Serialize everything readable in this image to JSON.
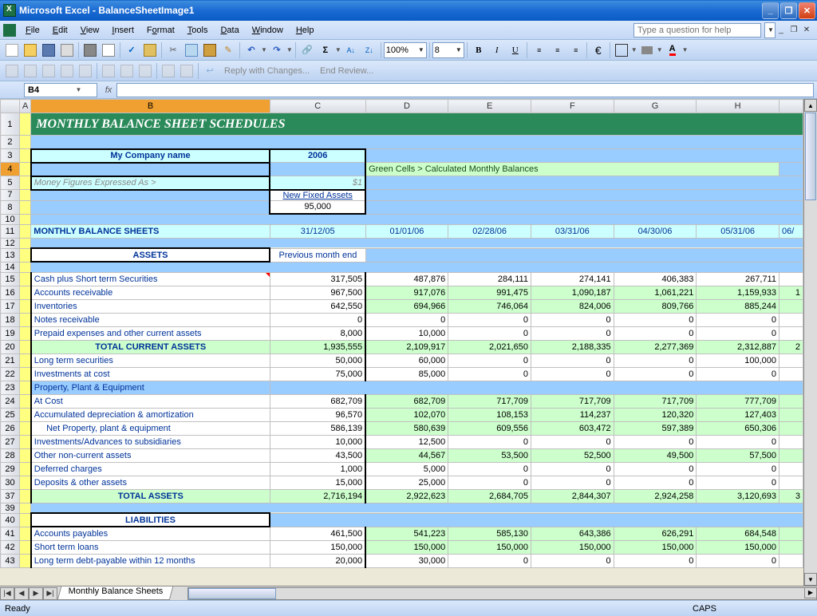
{
  "window": {
    "title": "Microsoft Excel - BalanceSheetImage1"
  },
  "menu": [
    "File",
    "Edit",
    "View",
    "Insert",
    "Format",
    "Tools",
    "Data",
    "Window",
    "Help"
  ],
  "help_placeholder": "Type a question for help",
  "toolbar": {
    "zoom": "100%",
    "font_size": "8",
    "reply_text": "Reply with Changes...",
    "end_review": "End Review..."
  },
  "cell_ref": "B4",
  "columns": [
    "A",
    "B",
    "C",
    "D",
    "E",
    "F",
    "G",
    "H"
  ],
  "sheet": {
    "title": "MONTHLY BALANCE SHEET SCHEDULES",
    "company_label": "My Company name",
    "year": "2006",
    "calc_note": "Green Cells > Calculated Monthly Balances",
    "money_expr": "Money Figures Expressed As >",
    "money_val": "$1",
    "new_fixed_assets_label": "New Fixed Assets",
    "new_fixed_assets_val": "95,000",
    "monthly_sheets": "MONTHLY BALANCE SHEETS",
    "prev_month": "Previous month end",
    "dates": [
      "31/12/05",
      "01/01/06",
      "02/28/06",
      "03/31/06",
      "04/30/06",
      "05/31/06"
    ],
    "date_partial": "06/",
    "assets_hdr": "ASSETS",
    "ppe_hdr": "Property, Plant & Equipment",
    "liab_hdr": "LIABILITIES",
    "rows": [
      {
        "n": "15",
        "lbl": "Cash plus Short term Securities",
        "c": "317,505",
        "v": [
          "487,876",
          "284,111",
          "274,141",
          "406,383",
          "267,711"
        ],
        "white": true,
        "red": true
      },
      {
        "n": "16",
        "lbl": "Accounts receivable",
        "c": "967,500",
        "v": [
          "917,076",
          "991,475",
          "1,090,187",
          "1,061,221",
          "1,159,933"
        ],
        "extra": "1"
      },
      {
        "n": "17",
        "lbl": "Inventories",
        "c": "642,550",
        "v": [
          "694,966",
          "746,064",
          "824,006",
          "809,766",
          "885,244"
        ]
      },
      {
        "n": "18",
        "lbl": "Notes receivable",
        "c": "0",
        "v": [
          "0",
          "0",
          "0",
          "0",
          "0"
        ],
        "white": true
      },
      {
        "n": "19",
        "lbl": "Prepaid expenses and other current assets",
        "c": "8,000",
        "v": [
          "10,000",
          "0",
          "0",
          "0",
          "0"
        ],
        "white": true
      },
      {
        "n": "20",
        "lbl": "TOTAL CURRENT ASSETS",
        "c": "1,935,555",
        "v": [
          "2,109,917",
          "2,021,650",
          "2,188,335",
          "2,277,369",
          "2,312,887"
        ],
        "total": true,
        "extra": "2"
      },
      {
        "n": "21",
        "lbl": "Long term securities",
        "c": "50,000",
        "v": [
          "60,000",
          "0",
          "0",
          "0",
          "100,000"
        ],
        "white": true
      },
      {
        "n": "22",
        "lbl": "Investments at cost",
        "c": "75,000",
        "v": [
          "85,000",
          "0",
          "0",
          "0",
          "0"
        ],
        "white": true
      },
      {
        "n": "24",
        "lbl": "At Cost",
        "c": "682,709",
        "v": [
          "682,709",
          "717,709",
          "717,709",
          "717,709",
          "777,709"
        ]
      },
      {
        "n": "25",
        "lbl": "Accumulated depreciation & amortization",
        "c": "96,570",
        "v": [
          "102,070",
          "108,153",
          "114,237",
          "120,320",
          "127,403"
        ]
      },
      {
        "n": "26",
        "lbl": "Net Property, plant & equipment",
        "c": "586,139",
        "v": [
          "580,639",
          "609,556",
          "603,472",
          "597,389",
          "650,306"
        ],
        "indent": true
      },
      {
        "n": "27",
        "lbl": "Investments/Advances to subsidiaries",
        "c": "10,000",
        "v": [
          "12,500",
          "0",
          "0",
          "0",
          "0"
        ],
        "white": true
      },
      {
        "n": "28",
        "lbl": "Other non-current assets",
        "c": "43,500",
        "v": [
          "44,567",
          "53,500",
          "52,500",
          "49,500",
          "57,500"
        ]
      },
      {
        "n": "29",
        "lbl": "Deferred charges",
        "c": "1,000",
        "v": [
          "5,000",
          "0",
          "0",
          "0",
          "0"
        ],
        "white": true
      },
      {
        "n": "30",
        "lbl": "Deposits & other assets",
        "c": "15,000",
        "v": [
          "25,000",
          "0",
          "0",
          "0",
          "0"
        ],
        "white": true
      },
      {
        "n": "37",
        "lbl": "TOTAL ASSETS",
        "c": "2,716,194",
        "v": [
          "2,922,623",
          "2,684,705",
          "2,844,307",
          "2,924,258",
          "3,120,693"
        ],
        "total": true,
        "extra": "3"
      },
      {
        "n": "41",
        "lbl": "Accounts payables",
        "c": "461,500",
        "v": [
          "541,223",
          "585,130",
          "643,386",
          "626,291",
          "684,548"
        ]
      },
      {
        "n": "42",
        "lbl": "Short term loans",
        "c": "150,000",
        "v": [
          "150,000",
          "150,000",
          "150,000",
          "150,000",
          "150,000"
        ]
      },
      {
        "n": "43",
        "lbl": "Long term debt-payable within 12 months",
        "c": "20,000",
        "v": [
          "30,000",
          "0",
          "0",
          "0",
          "0"
        ],
        "white": true
      }
    ]
  },
  "sheet_tab": "Monthly Balance Sheets",
  "status": {
    "ready": "Ready",
    "caps": "CAPS"
  }
}
